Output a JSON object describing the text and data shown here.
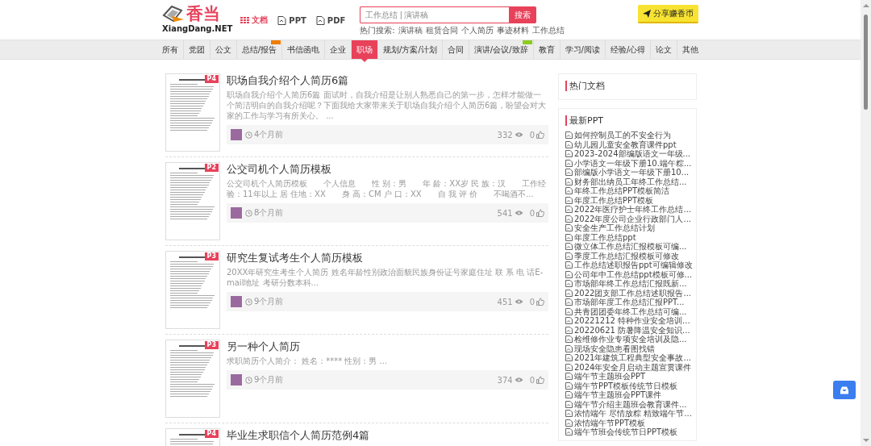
{
  "header": {
    "logo": {
      "name": "香当",
      "domain": "XiangDang.NET"
    },
    "doc_types": [
      {
        "label": "文档",
        "kind": "grid",
        "selected": true
      },
      {
        "label": "PPT",
        "kind": "file",
        "selected": false
      },
      {
        "label": "PDF",
        "kind": "file",
        "selected": false
      }
    ],
    "search": {
      "placeholder": "工作总结 | 演讲稿",
      "button": "搜索"
    },
    "hot_search": {
      "label": "热门搜索:",
      "terms": [
        "演讲稿",
        "租赁合同",
        "个人简历",
        "事迹材料",
        "工作总结"
      ]
    },
    "share_button": "分享赚香币"
  },
  "nav": [
    {
      "label": "所有",
      "selected": false
    },
    {
      "label": "党团",
      "selected": false
    },
    {
      "label": "公文",
      "selected": false
    },
    {
      "label": "总结/报告",
      "selected": false,
      "badge": {
        "color": "#f07c00"
      }
    },
    {
      "label": "书信函电",
      "selected": false
    },
    {
      "label": "企业",
      "selected": false
    },
    {
      "label": "职场",
      "selected": true
    },
    {
      "label": "规划/方案/计划",
      "selected": false
    },
    {
      "label": "合同",
      "selected": false
    },
    {
      "label": "演讲/会议/致辞",
      "selected": false,
      "badge": {
        "color": "#8ccc20"
      }
    },
    {
      "label": "教育",
      "selected": false
    },
    {
      "label": "学习/阅读",
      "selected": false
    },
    {
      "label": "经验/心得",
      "selected": false
    },
    {
      "label": "论文",
      "selected": false
    },
    {
      "label": "其他",
      "selected": false
    }
  ],
  "documents": [
    {
      "title": "职场自我介绍个人简历6篇",
      "pages": "P4",
      "summary": "职场自我介绍个人简历6篇 面试时，自我介绍是让别人熟悉自己的第一步，怎样才能做一个简洁明白的自我介绍呢？下面我给大家带来关于职场自我介绍个人简历6篇，盼望会对大家的工作与学习有所关心。 ...",
      "time": "4个月前",
      "views": "332",
      "likes": "0"
    },
    {
      "title": "公交司机个人简历模板",
      "pages": "P2",
      "summary": "公交司机个人简历模板　　个人信息　　性 别：男　　年 龄：XX岁 民 族：汉　　工作经验：11年以上 居 住地：XX　　身 高：CM 户 口：XX　　自 我 评 价　　不喝酒不...",
      "time": "8个月前",
      "views": "541",
      "likes": "0"
    },
    {
      "title": "研究生复试考生个人简历模板",
      "pages": "P3",
      "summary": "20XX年研究生考生个人简历 姓名年龄性别政治面貌民族身份证号家庭住址 联 系 电 话E-mail地址 考研分数本科...",
      "time": "9个月前",
      "views": "451",
      "likes": "0"
    },
    {
      "title": "另一种个人简历",
      "pages": "P3",
      "summary": "求职简历个人简介： 姓名：**** 性别：男 ...",
      "time": "9个月前",
      "views": "374",
      "likes": "0"
    },
    {
      "title": "毕业生求职信个人简历范例4篇",
      "pages": "P4"
    }
  ],
  "sidebar": {
    "hot_docs": {
      "title": "热门文档"
    },
    "latest_ppt": {
      "title": "最新PPT",
      "items": [
        "如何控制员工的不安全行为",
        "幼儿园儿童安全教育课件ppt",
        "2023-2024部编版语文一年级...",
        "小学语文一年级下册10.端午粽...",
        "部编版小学语文一年级下册10...",
        "财务部出纳员工年终工作总结...",
        "年终工作总结PPT模板简洁",
        "年度工作总结PPT模板",
        "2022年医疗护士年终工作总结...",
        "2022年度公司企业行政部门人...",
        "安全生产工作总结计划",
        "年度工作总结ppt",
        "微立体工作总结汇报模板可编...",
        "季度工作总结汇报模板可修改",
        "工作总结述职报告ppt可编辑修改",
        "公司年中工作总结ppt模板可修...",
        "市场部年终工作总结汇报既新...",
        "2022团支部工作总结述职报告...",
        "市场部年度工作总结汇报PPT...",
        "共青团团委年终工作总结可编...",
        "20221212 特种作业安全培训...",
        "20220621 防暑降温安全知识...",
        "检维修作业专项安全培训及隐...",
        "现场安全隐患看图找错",
        "2021年建筑工程典型安全事故...",
        "2024年安全月启动主题宣贯课件",
        "端午节主题班会PPT",
        "端午节PPT模板传统节日模板",
        "端午节主题班会PPT课件",
        "端午节介绍主题班会教育课件...",
        "浓情端午 尽情放粽 精致端午节...",
        "浓情端午节PPT模板",
        "端午节班会传统节日PPT模板"
      ]
    }
  }
}
